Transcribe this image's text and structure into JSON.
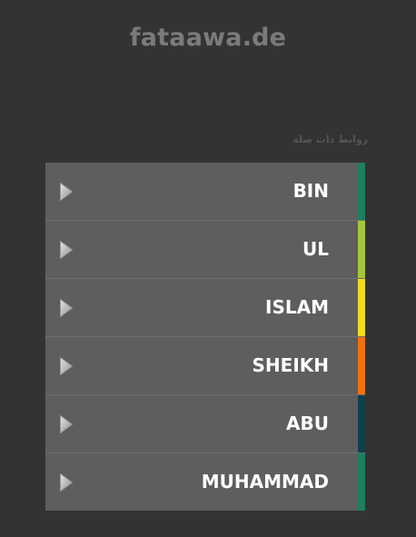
{
  "header": {
    "site_title": "fataawa.de"
  },
  "related_links": {
    "section_label": "روابط ذات صلة",
    "items": [
      {
        "label": "BIN",
        "accent_color": "#1d7f5f"
      },
      {
        "label": "UL",
        "accent_color": "#a5c63b"
      },
      {
        "label": "ISLAM",
        "accent_color": "#f1dc1e"
      },
      {
        "label": "SHEIKH",
        "accent_color": "#f2720d"
      },
      {
        "label": "ABU",
        "accent_color": "#12404a"
      },
      {
        "label": "MUHAMMAD",
        "accent_color": "#1d7f5f"
      }
    ],
    "item_icon": "play-arrow-icon"
  }
}
